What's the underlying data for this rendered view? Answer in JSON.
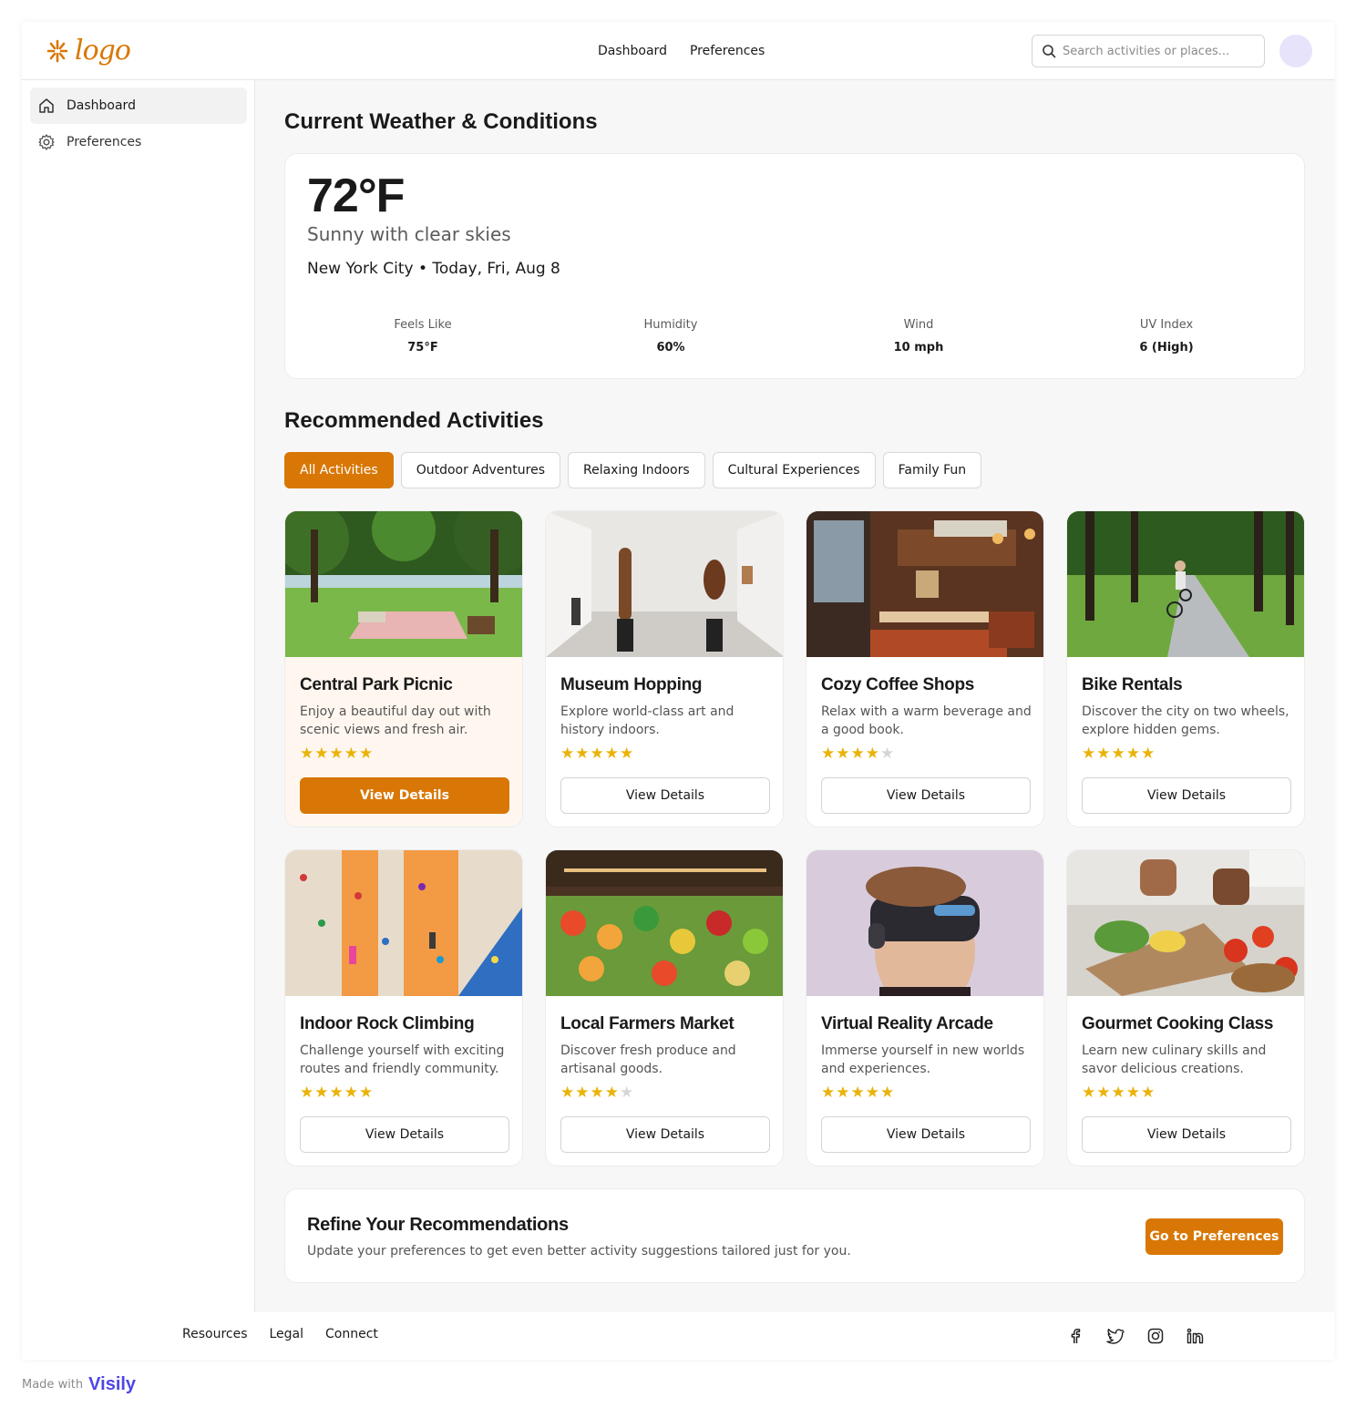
{
  "header": {
    "logo_text": "logo",
    "nav": [
      "Dashboard",
      "Preferences"
    ],
    "search_placeholder": "Search activities or places..."
  },
  "sidebar": {
    "items": [
      {
        "label": "Dashboard",
        "icon": "home-icon",
        "active": true
      },
      {
        "label": "Preferences",
        "icon": "gear-icon",
        "active": false
      }
    ]
  },
  "weather": {
    "heading": "Current Weather & Conditions",
    "temperature": "72°F",
    "condition": "Sunny with clear skies",
    "location": "New York City • Today, Fri, Aug 8",
    "stats": [
      {
        "label": "Feels Like",
        "value": "75°F"
      },
      {
        "label": "Humidity",
        "value": "60%"
      },
      {
        "label": "Wind",
        "value": "10 mph"
      },
      {
        "label": "UV Index",
        "value": "6 (High)"
      }
    ]
  },
  "activities": {
    "heading": "Recommended Activities",
    "filters": [
      "All Activities",
      "Outdoor Adventures",
      "Relaxing Indoors",
      "Cultural Experiences",
      "Family Fun"
    ],
    "active_filter": "All Activities",
    "button_label": "View Details",
    "items": [
      {
        "title": "Central Park Picnic",
        "desc": "Enjoy a beautiful day out with scenic views and fresh air.",
        "rating": 5,
        "image": "park-picnic-image"
      },
      {
        "title": "Museum Hopping",
        "desc": "Explore world-class art and history indoors.",
        "rating": 5,
        "image": "museum-gallery-image"
      },
      {
        "title": "Cozy Coffee Shops",
        "desc": "Relax with a warm beverage and a good book.",
        "rating": 4,
        "image": "coffee-shop-image"
      },
      {
        "title": "Bike Rentals",
        "desc": "Discover the city on two wheels, explore hidden gems.",
        "rating": 5,
        "image": "bike-path-image"
      },
      {
        "title": "Indoor Rock Climbing",
        "desc": "Challenge yourself with exciting routes and friendly community.",
        "rating": 5,
        "image": "climbing-wall-image"
      },
      {
        "title": "Local Farmers Market",
        "desc": "Discover fresh produce and artisanal goods.",
        "rating": 4,
        "image": "farmers-market-image"
      },
      {
        "title": "Virtual Reality Arcade",
        "desc": "Immerse yourself in new worlds and experiences.",
        "rating": 5,
        "image": "vr-headset-image"
      },
      {
        "title": "Gourmet Cooking Class",
        "desc": "Learn new culinary skills and savor delicious creations.",
        "rating": 5,
        "image": "cooking-class-image"
      }
    ]
  },
  "refine": {
    "title": "Refine Your Recommendations",
    "desc": "Update your preferences to get even better activity suggestions tailored just for you.",
    "button": "Go to Preferences"
  },
  "footer": {
    "links": [
      "Resources",
      "Legal",
      "Connect"
    ],
    "socials": [
      "facebook-icon",
      "twitter-icon",
      "instagram-icon",
      "linkedin-icon"
    ]
  },
  "badge": {
    "made_with": "Made with",
    "brand": "Visily"
  },
  "colors": {
    "accent": "#d97706",
    "star": "#eab308",
    "avatar": "#e7e3fb"
  }
}
